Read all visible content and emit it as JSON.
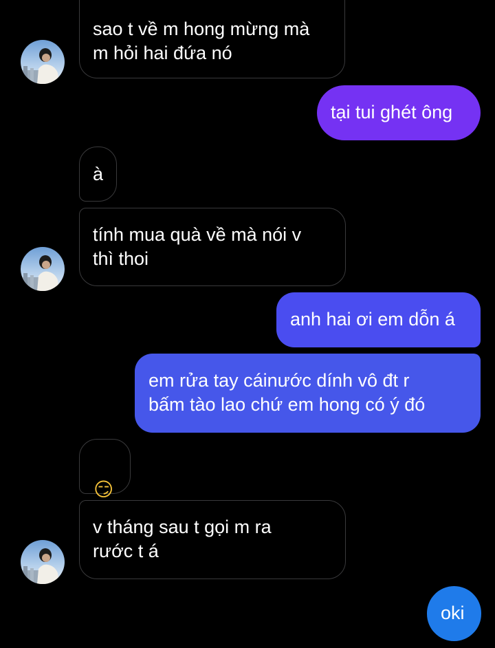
{
  "chat": {
    "messages": [
      {
        "sender": "them",
        "text": "sao t về m hong mừng mà\nm hỏi hai đứa nó"
      },
      {
        "sender": "me",
        "text": "tại tui ghét ông"
      },
      {
        "sender": "them",
        "text": "à"
      },
      {
        "sender": "them",
        "text": "tính mua quà về mà nói v\nthì thoi"
      },
      {
        "sender": "me",
        "text": "anh hai ơi em dỗn á"
      },
      {
        "sender": "me",
        "text": "em rửa tay cáinước dính vô đt r\nbấm tào lao chứ em hong có ý đó"
      },
      {
        "sender": "them",
        "text": "😏"
      },
      {
        "sender": "them",
        "text": "v tháng sau t gọi m ra\nrước t á"
      },
      {
        "sender": "me",
        "text": "oki"
      }
    ]
  },
  "colors": {
    "background": "#000000",
    "received_bubble_border": "#3a3a3c",
    "sent_gradient_top": "#7b2ff7",
    "sent_gradient_mid": "#4a55ec",
    "sent_gradient_bottom": "#1f7bea"
  },
  "avatar": {
    "icon": "contact-photo-icon"
  }
}
